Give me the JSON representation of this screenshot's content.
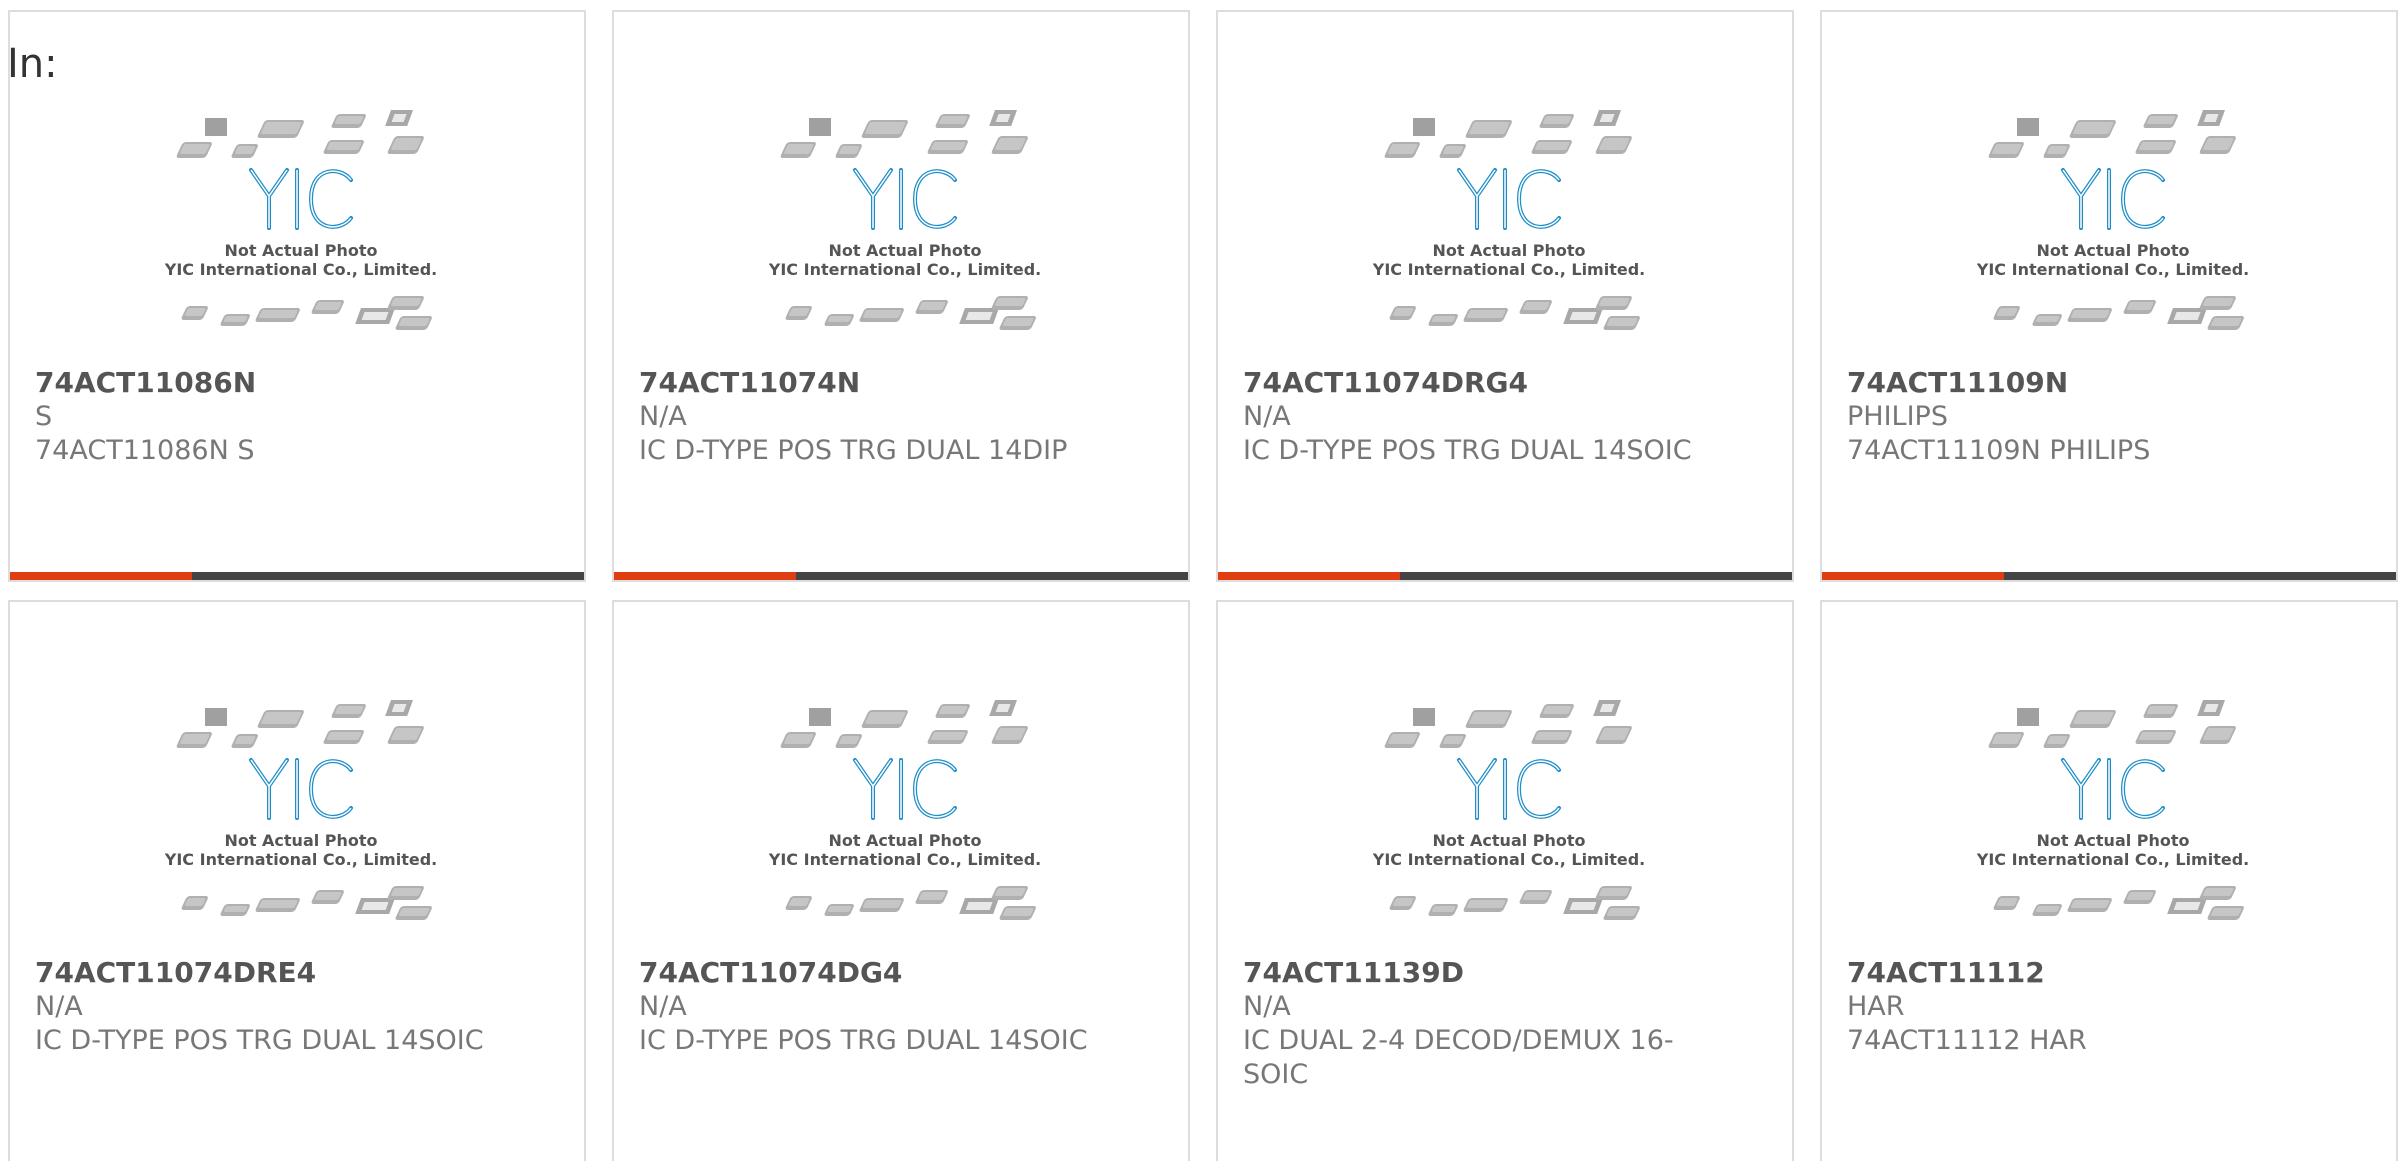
{
  "header": {
    "in_label": "In:"
  },
  "placeholder": {
    "logo_text": "YIC",
    "line1": "Not Actual Photo",
    "line2": "YIC International Co., Limited."
  },
  "colors": {
    "accent": "#e23c12",
    "bar": "#444444",
    "logo": "#1f8fc7"
  },
  "products": [
    {
      "part_number": "74ACT11086N",
      "manufacturer": "S",
      "description": "74ACT11086N S"
    },
    {
      "part_number": "74ACT11074N",
      "manufacturer": "N/A",
      "description": "IC D-TYPE POS TRG DUAL 14DIP"
    },
    {
      "part_number": "74ACT11074DRG4",
      "manufacturer": "N/A",
      "description": "IC D-TYPE POS TRG DUAL 14SOIC"
    },
    {
      "part_number": "74ACT11109N",
      "manufacturer": "PHILIPS",
      "description": "74ACT11109N PHILIPS"
    },
    {
      "part_number": "74ACT11074DRE4",
      "manufacturer": "N/A",
      "description": "IC D-TYPE POS TRG DUAL 14SOIC"
    },
    {
      "part_number": "74ACT11074DG4",
      "manufacturer": "N/A",
      "description": "IC D-TYPE POS TRG DUAL 14SOIC"
    },
    {
      "part_number": "74ACT11139D",
      "manufacturer": "N/A",
      "description": "IC DUAL 2-4 DECOD/DEMUX 16-SOIC"
    },
    {
      "part_number": "74ACT11112",
      "manufacturer": "HAR",
      "description": "74ACT11112 HAR"
    }
  ]
}
